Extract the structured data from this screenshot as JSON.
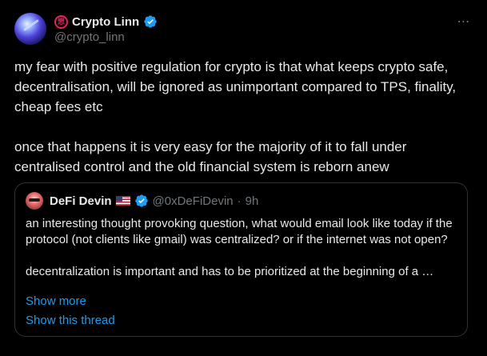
{
  "author": {
    "display_name": "Crypto Linn",
    "seal_glyph": "愳",
    "handle": "@crypto_linn",
    "verified_color": "#1d9bf0",
    "avatar_icon": "avatar-image"
  },
  "more_icon": "⋯",
  "tweet": {
    "paragraph_1": "my fear with positive regulation for crypto is that what keeps crypto safe, decentralisation, will be ignored as unimportant compared to TPS, finality, cheap fees etc",
    "paragraph_2": "once that happens it is very easy for the majority of it to fall under centralised control and the old financial system is reborn anew"
  },
  "quote": {
    "display_name": "DeFi Devin",
    "flag_icon": "us-flag-icon",
    "handle": "@0xDeFiDevin",
    "dot": "·",
    "time": "9h",
    "paragraph_1": "an interesting thought provoking question, what would email look like today if the protocol (not clients like gmail) was centralized? or if the internet was not open?",
    "paragraph_2": "decentralization is important and has to be prioritized at the beginning of a …",
    "show_more": "Show more",
    "show_thread": "Show this thread"
  },
  "colors": {
    "background": "#000000",
    "text": "#e7e9ea",
    "muted": "#71767b",
    "link": "#1d9bf0",
    "border": "#2f3336"
  }
}
